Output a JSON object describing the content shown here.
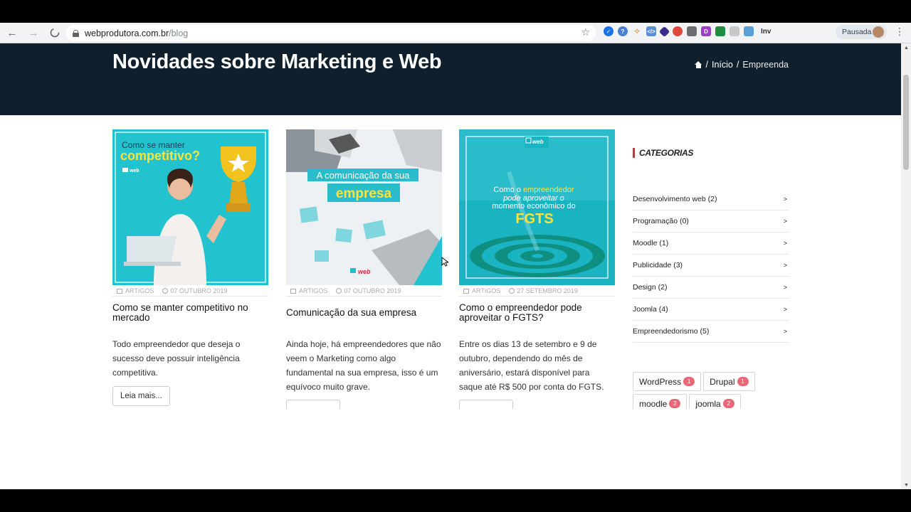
{
  "browser": {
    "url_domain": "webprodutora.com.br",
    "url_path": "/blog",
    "ext_label": "Inv",
    "profile_label": "Pausada"
  },
  "hero": {
    "title": "Novidades sobre Marketing e Web",
    "breadcrumb": [
      "/",
      "Início",
      "/",
      "Empreenda"
    ]
  },
  "posts": [
    {
      "category": "ARTIGOS",
      "date": "07 OUTUBRO 2019",
      "title": "Como se manter competitivo no mercado",
      "excerpt": "Todo empreendedor que deseja o sucesso deve possuir inteligência competitiva.",
      "readmore": "Leia mais...",
      "image_text": [
        "Como se manter",
        "competitivo?"
      ]
    },
    {
      "category": "ARTIGOS",
      "date": "07 OUTUBRO 2019",
      "title": "Comunicação da sua empresa",
      "excerpt": "Ainda hoje, há empreendedores que não veem o Marketing como algo fundamental na sua empresa, isso é um equívoco muito grave.",
      "readmore": "",
      "image_text": [
        "A comunicação da sua",
        "empresa"
      ]
    },
    {
      "category": "ARTIGOS",
      "date": "27 SETEMBRO 2019",
      "title": "Como o empreendedor pode aproveitar o FGTS?",
      "excerpt": "Entre os dias 13 de setembro e 9 de outubro, dependendo do mês de aniversário, estará disponível para saque até R$ 500 por conta do FGTS.",
      "readmore": "",
      "image_text": [
        "Como o empreendedor",
        "pode aproveitar o",
        "momento econômico do",
        "FGTS"
      ]
    }
  ],
  "sidebar": {
    "title": "CATEGORIAS",
    "categories": [
      {
        "label": "Desenvolvimento web (2)"
      },
      {
        "label": "Programação (0)"
      },
      {
        "label": "Moodle (1)"
      },
      {
        "label": "Publicidade (3)"
      },
      {
        "label": "Design (2)"
      },
      {
        "label": "Joomla (4)"
      },
      {
        "label": "Empreendedorismo (5)"
      }
    ],
    "chevron": ">",
    "tags": [
      {
        "name": "WordPress",
        "count": "1"
      },
      {
        "name": "Drupal",
        "count": "1"
      },
      {
        "name": "moodle",
        "count": "2"
      },
      {
        "name": "joomla",
        "count": "2"
      }
    ]
  },
  "colors": {
    "hero_bg": "#0f1f2c",
    "accent": "#d42b3a",
    "tag_badge": "#e96877",
    "teal": "#22c3cf"
  },
  "logo_text": "web"
}
